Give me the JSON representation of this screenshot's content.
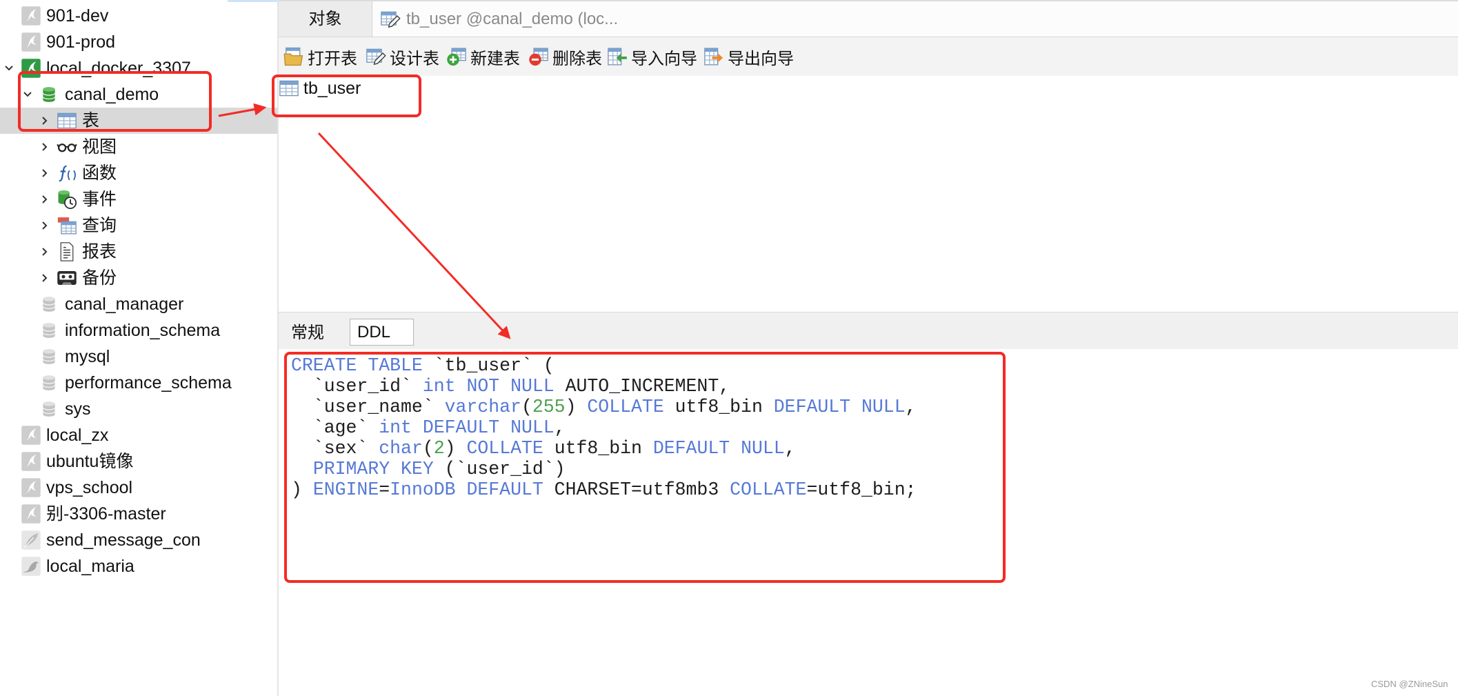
{
  "tabs": {
    "objects": "对象",
    "editor": "tb_user @canal_demo (loc..."
  },
  "sidebar": {
    "items": [
      {
        "label": "901-dev"
      },
      {
        "label": "901-prod"
      },
      {
        "label": "local_docker_3307"
      },
      {
        "label": "canal_demo"
      },
      {
        "label": "表"
      },
      {
        "label": "视图"
      },
      {
        "label": "函数"
      },
      {
        "label": "事件"
      },
      {
        "label": "查询"
      },
      {
        "label": "报表"
      },
      {
        "label": "备份"
      },
      {
        "label": "canal_manager"
      },
      {
        "label": "information_schema"
      },
      {
        "label": "mysql"
      },
      {
        "label": "performance_schema"
      },
      {
        "label": "sys"
      },
      {
        "label": "local_zx"
      },
      {
        "label": "ubuntu镜像"
      },
      {
        "label": "vps_school"
      },
      {
        "label": "别-3306-master"
      },
      {
        "label": "send_message_con"
      },
      {
        "label": "local_maria"
      }
    ]
  },
  "toolbar": {
    "open_table": "打开表",
    "design_table": "设计表",
    "new_table": "新建表",
    "delete_table": "删除表",
    "import_wizard": "导入向导",
    "export_wizard": "导出向导"
  },
  "objects": {
    "items": [
      {
        "name": "tb_user"
      }
    ]
  },
  "detail_tabs": {
    "general": "常规",
    "ddl": "DDL"
  },
  "ddl": {
    "lines": [
      [
        {
          "text": "CREATE TABLE",
          "color": "#5679d6"
        },
        {
          "text": " `tb_user` ("
        }
      ],
      [
        {
          "text": "  `user_id` "
        },
        {
          "text": "int NOT NULL",
          "color": "#5679d6"
        },
        {
          "text": " AUTO_INCREMENT,"
        }
      ],
      [
        {
          "text": "  `user_name` "
        },
        {
          "text": "varchar",
          "color": "#5679d6"
        },
        {
          "text": "("
        },
        {
          "text": "255",
          "color": "#4e9f4e"
        },
        {
          "text": ") "
        },
        {
          "text": "COLLATE",
          "color": "#5679d6"
        },
        {
          "text": " utf8_bin "
        },
        {
          "text": "DEFAULT NULL",
          "color": "#5679d6"
        },
        {
          "text": ","
        }
      ],
      [
        {
          "text": "  `age` "
        },
        {
          "text": "int DEFAULT NULL",
          "color": "#5679d6"
        },
        {
          "text": ","
        }
      ],
      [
        {
          "text": "  `sex` "
        },
        {
          "text": "char",
          "color": "#5679d6"
        },
        {
          "text": "("
        },
        {
          "text": "2",
          "color": "#4e9f4e"
        },
        {
          "text": ") "
        },
        {
          "text": "COLLATE",
          "color": "#5679d6"
        },
        {
          "text": " utf8_bin "
        },
        {
          "text": "DEFAULT NULL",
          "color": "#5679d6"
        },
        {
          "text": ","
        }
      ],
      [
        {
          "text": "  "
        },
        {
          "text": "PRIMARY KEY",
          "color": "#5679d6"
        },
        {
          "text": " (`user_id`)"
        }
      ],
      [
        {
          "text": ") "
        },
        {
          "text": "ENGINE",
          "color": "#5679d6"
        },
        {
          "text": "="
        },
        {
          "text": "InnoDB DEFAULT",
          "color": "#5679d6"
        },
        {
          "text": " CHARSET=utf8mb3 "
        },
        {
          "text": "COLLATE",
          "color": "#5679d6"
        },
        {
          "text": "=utf8_bin;"
        }
      ]
    ]
  },
  "watermark": "CSDN @ZNineSun",
  "colors": {
    "selection": "#d9d9d9",
    "annotation": "#f32b25",
    "keyword": "#5679d6",
    "number": "#4e9f4e"
  }
}
